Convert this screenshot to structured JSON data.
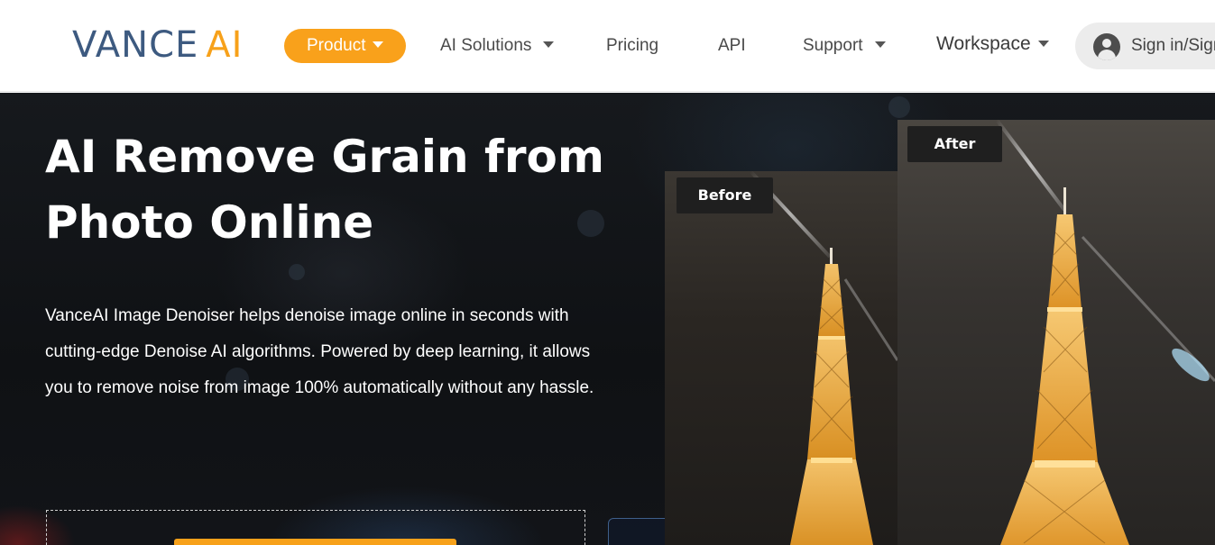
{
  "header": {
    "logo": {
      "part1": "VANCE",
      "part2": "AI"
    },
    "nav": {
      "product": "Product",
      "ai_solutions": "AI Solutions",
      "pricing": "Pricing",
      "api": "API",
      "support": "Support",
      "workspace": "Workspace"
    },
    "signin": "Sign in/Sign up"
  },
  "hero": {
    "title_line1": "AI Remove Grain from",
    "title_line2": "Photo Online",
    "description": "VanceAI Image Denoiser helps denoise image online in seconds with cutting-edge Denoise AI algorithms. Powered by deep learning, it allows you to remove noise from image 100% automatically without any hassle.",
    "before_label": "Before",
    "after_label": "After"
  },
  "colors": {
    "brand_blue": "#3d5a80",
    "brand_orange": "#f7a11a",
    "hero_bg": "#121418"
  }
}
